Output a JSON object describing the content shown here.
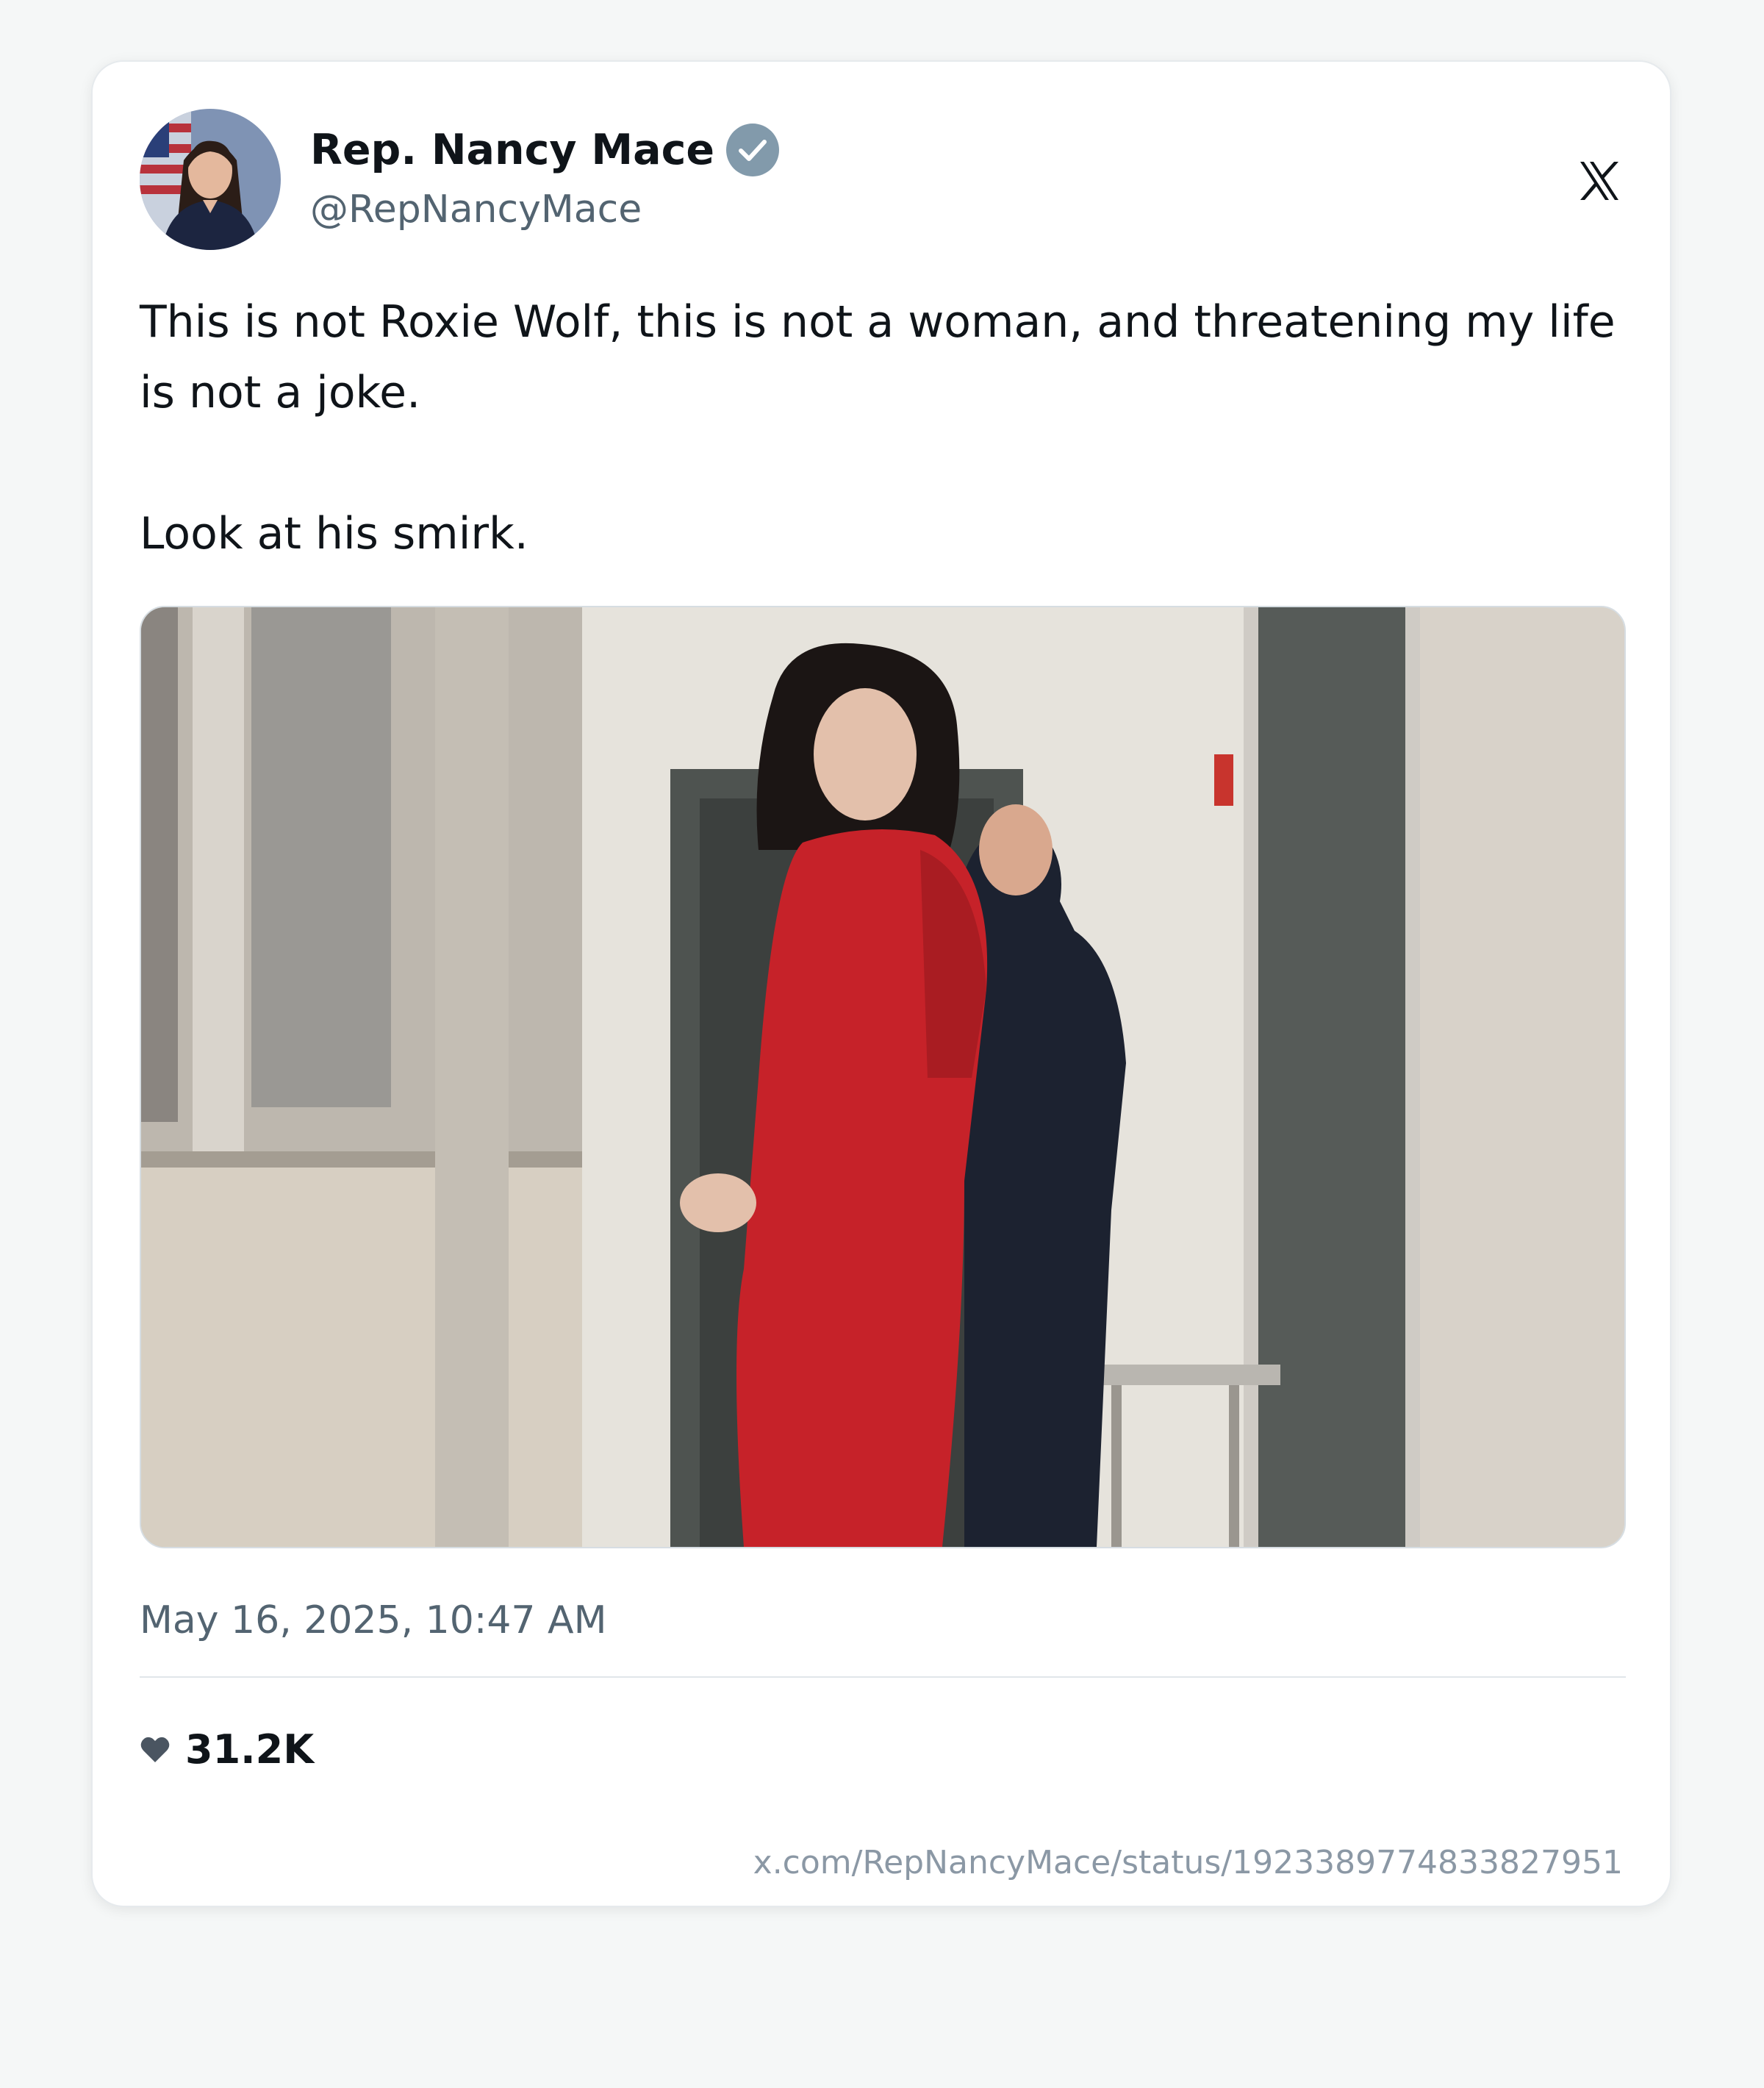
{
  "author": {
    "display_name": "Rep. Nancy Mace",
    "handle": "@RepNancyMace",
    "verified": true,
    "avatar_icon": "profile-photo"
  },
  "platform": {
    "logo_icon": "x-logo"
  },
  "tweet": {
    "text_line_1": "This is not Roxie Wolf, this is not a woman, and threatening my life is not a joke.",
    "text_line_2": "Look at his smirk.",
    "media_icon": "photo"
  },
  "meta": {
    "timestamp": "May 16, 2025, 10:47 AM",
    "likes": "31.2K",
    "like_icon": "heart-icon",
    "url": "x.com/RepNancyMace/status/1923389774833827951"
  },
  "colors": {
    "text": "#0f1419",
    "secondary": "#536471",
    "verified_badge": "#829aab",
    "url": "#8b98a5"
  }
}
